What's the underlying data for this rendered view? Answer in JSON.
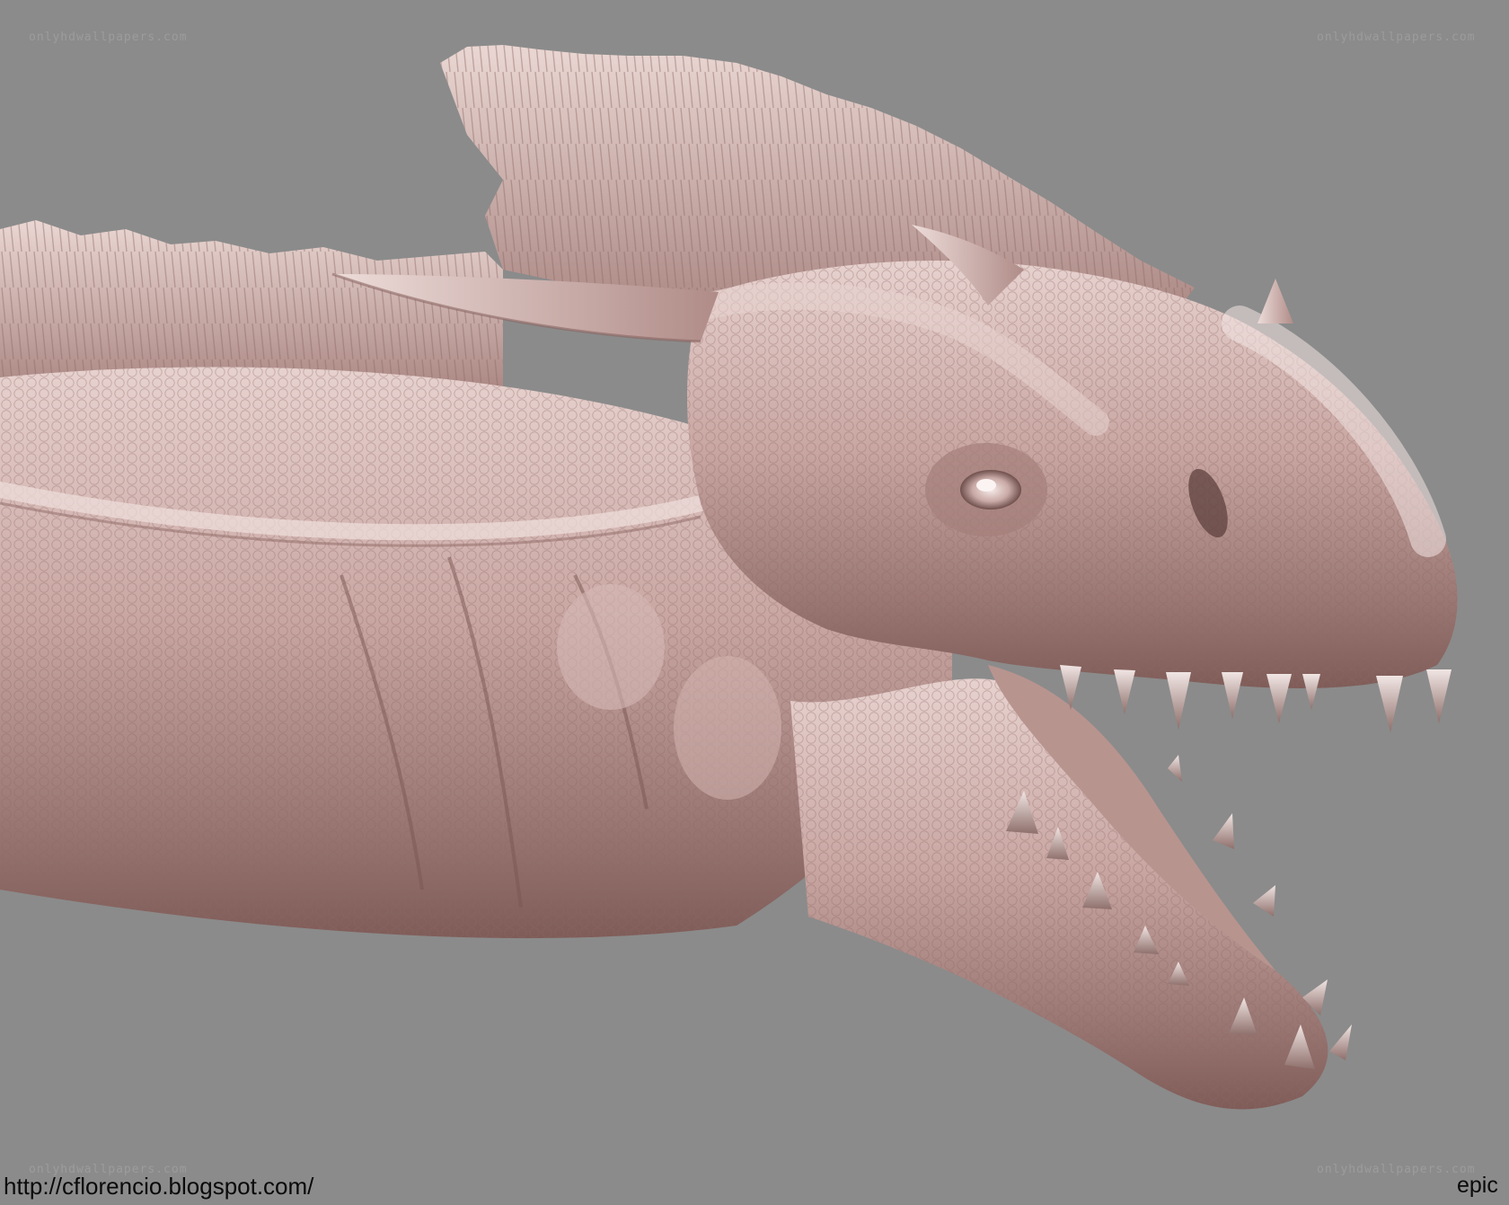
{
  "image": {
    "subject": "sculpted dragon head with open jaws",
    "background_color": "#8b8b8b",
    "skin_color": "#c9a8a4"
  },
  "watermarks": {
    "top_left": "onlyhdwallpapers.com",
    "top_right": "onlyhdwallpapers.com",
    "bottom_left": "onlyhdwallpapers.com",
    "bottom_right": "onlyhdwallpapers.com"
  },
  "caption": {
    "url": "http://cflorencio.blogspot.com/",
    "tag": "epic"
  }
}
